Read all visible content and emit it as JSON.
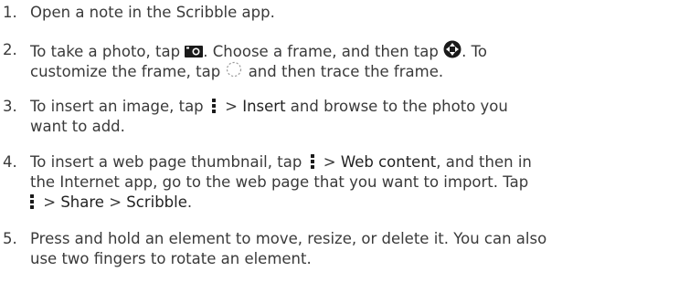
{
  "steps": [
    {
      "number": "1.",
      "line1": "Open a note in the Scribble app."
    },
    {
      "number": "2.",
      "line1_a": "To take a photo, tap ",
      "line1_b": ". Choose a frame, and then tap ",
      "line1_c": ". To",
      "line2_a": "customize the frame, tap ",
      "line2_b": " and then trace the frame."
    },
    {
      "number": "3.",
      "line1_a": "To insert an image, tap ",
      "line1_b": " > ",
      "line1_insert": "Insert",
      "line1_c": " and browse to the photo you",
      "line2": "want to add."
    },
    {
      "number": "4.",
      "line1_a": "To insert a web page thumbnail, tap ",
      "line1_b": " > ",
      "line1_web": "Web content",
      "line1_c": ", and then in",
      "line2": "the Internet app, go to the web page that you want to import. Tap",
      "line3_a": " > ",
      "line3_share": "Share",
      "line3_b": " > ",
      "line3_scribble": "Scribble",
      "line3_c": "."
    },
    {
      "number": "5.",
      "line1": "Press and hold an element to move, resize, or delete it. You can also",
      "line2": "use two fingers to rotate an element."
    }
  ],
  "icons": {
    "camera": "camera-icon",
    "shutter": "shutter-icon",
    "custom_frame": "lasso-icon",
    "menu": "more-menu-icon"
  }
}
